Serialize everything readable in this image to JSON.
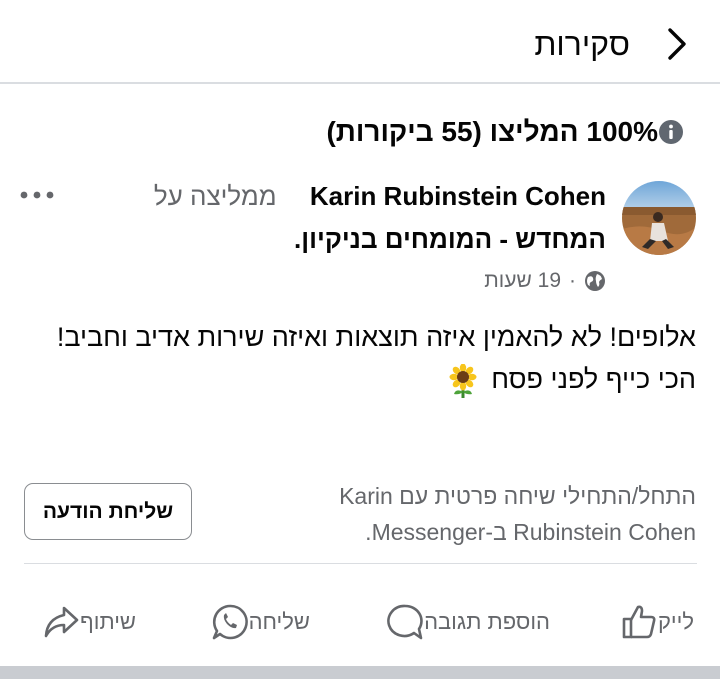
{
  "header": {
    "title": "סקירות",
    "back_icon": "chevron-right-icon"
  },
  "recommendation": {
    "title": "100% המליצו (55 ביקורות)",
    "info_icon": "info-icon"
  },
  "post": {
    "author": "Karin Rubinstein Cohen",
    "recommends_label": "ממליצה על",
    "page_name": "המחדש - המומחים בניקיון",
    "page_name_suffix": ".",
    "time": "19 שעות",
    "separator": "·",
    "privacy_icon": "globe-icon",
    "more_icon": "more-options-icon",
    "text_line1": "אלופים! לא להאמין איזה תוצאות ואיזה שירות אדיב וחביב!",
    "text_line2": "הכי כייף לפני פסח",
    "emoji": "sunflower-emoji"
  },
  "messenger": {
    "prompt_line1": "התחל/התחילי שיחה פרטית עם Karin",
    "prompt_line2": "Rubinstein Cohen ב-Messenger.",
    "button_label": "שליחת הודעה"
  },
  "actions": {
    "like": "לייק",
    "comment": "הוספת תגובה",
    "send": "שליחה",
    "share": "שיתוף"
  },
  "colors": {
    "text": "#050505",
    "secondary": "#65676b",
    "divider": "#dadde1"
  }
}
